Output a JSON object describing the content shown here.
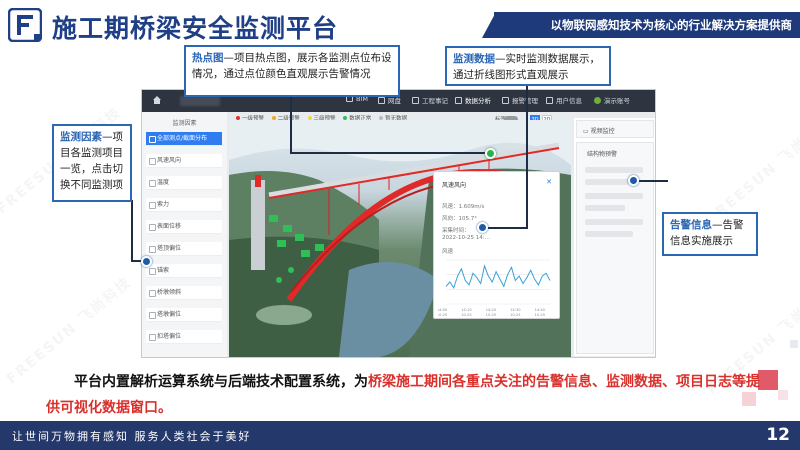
{
  "header": {
    "title": "施工期桥梁安全监测平台",
    "banner": "以物联网感知技术为核心的行业解决方案提供商",
    "logo_letter": "F",
    "colors": {
      "primary": "#1f3f86",
      "banner": "#1e3a7b",
      "accent_red": "#d9302c"
    }
  },
  "footer": {
    "slogan": "让世间万物拥有感知    服务人类社会于美好",
    "page_number": "12"
  },
  "watermark": "FREESUN 飞尚科技",
  "app": {
    "nav": {
      "items": [
        {
          "icon": "bridge-icon",
          "label": "BIM"
        },
        {
          "icon": "network-icon",
          "label": "网盘"
        },
        {
          "icon": "log-icon",
          "label": "工程事记"
        },
        {
          "icon": "data-icon",
          "label": "数据分析"
        },
        {
          "icon": "alarm-icon",
          "label": "报警管理"
        },
        {
          "icon": "user-icon",
          "label": "用户信息"
        },
        {
          "icon": "avatar-icon",
          "label": "演示账号"
        }
      ]
    },
    "left_panel": {
      "heading": "监测因素",
      "items": [
        "全部测点/截面分布",
        "风速风向",
        "温度",
        "索力",
        "表面位移",
        "塔顶偏位",
        "锚索",
        "桥墩倾斜",
        "塔墩偏位",
        "扣塔偏位"
      ]
    },
    "legend": [
      "一级预警",
      "二级预警",
      "三级预警",
      "数据正常",
      "暂无数据"
    ],
    "legend_colors": [
      "#e0312d",
      "#f5a623",
      "#f0d64b",
      "#2fbf57",
      "#b8bcc2"
    ],
    "toggle_label": "标签",
    "view_buttons": [
      "3D",
      "2D"
    ],
    "popup": {
      "title": "风速风向",
      "lines": [
        "风速：1.609m/s",
        "风向：105.7°",
        "采集时间：",
        "2022-10-25 14:…",
        "风速"
      ],
      "x_ticks": [
        "14:00\n10-25",
        "14:05\n10-25",
        "14:10\n10-25",
        "14:15\n10-25",
        "14:20\n10-25",
        "14:25\n10-25",
        "14:30\n10-25",
        "14:35\n10-25",
        "14:40\n10-25",
        "14:45\n10-25"
      ]
    },
    "right_panel": {
      "video_title": "视频监控",
      "alarm_title": "结构物预警"
    }
  },
  "callouts": {
    "hotspot": {
      "keyword": "热点图",
      "text": "—项目热点图，展示各监测点位布设情况，通过点位颜色直观展示告警情况"
    },
    "data": {
      "keyword": "监测数据",
      "text": "—实时监测数据展示，通过折线图形式直观展示"
    },
    "factors": {
      "keyword": "监测因素",
      "text": "—项目各监测项目一览，点击切换不同监测项"
    },
    "alarm": {
      "keyword": "告警信息",
      "text": "—告警信息实施展示"
    }
  },
  "caption": {
    "part1": "平台内置解析运算系统与后端技术配置系统，为",
    "part2": "桥梁施工期间各重点关注的告警信息、监测数据、项目日志等提供可视化数据窗口。"
  },
  "chart_data": {
    "type": "line",
    "title": "风速",
    "series": [
      {
        "values": [
          1.2,
          1.5,
          1.1,
          1.9,
          2.4,
          1.6,
          1.3,
          2.1,
          1.8,
          1.4,
          2.6,
          1.9,
          1.5,
          2.2,
          1.7,
          1.2,
          2.0,
          2.5,
          1.6,
          1.9,
          1.4,
          1.8,
          2.3,
          1.7,
          1.3,
          1.9,
          2.1,
          1.6
        ]
      }
    ],
    "ylim": [
      0,
      3
    ],
    "grid": true
  }
}
